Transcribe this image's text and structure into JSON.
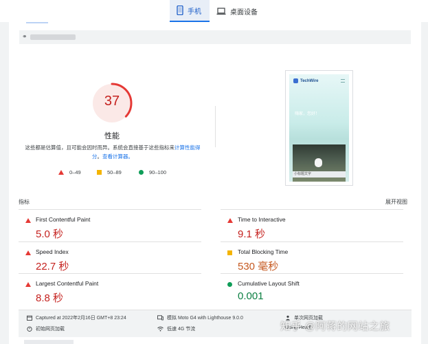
{
  "tabs": [
    {
      "label": "手机",
      "icon": "smartphone-icon",
      "active": true
    },
    {
      "label": "桌面设备",
      "icon": "laptop-icon",
      "active": false
    }
  ],
  "url_bar": {
    "link_icon": "link-icon"
  },
  "performance": {
    "score": "37",
    "score_fraction": 0.37,
    "score_color": "#c5221f",
    "title": "性能",
    "description_prefix": "这些都是估算值，且可能会因时而异。系统会直接基于这些指标来",
    "calc_link": "计算性能得分",
    "description_mid": "。",
    "calculator_link": "查看计算器。"
  },
  "legend": [
    {
      "label": "0–49",
      "shape": "triangle",
      "color": "#e53935"
    },
    {
      "label": "50–89",
      "shape": "square",
      "color": "#f4b400"
    },
    {
      "label": "90–100",
      "shape": "circle",
      "color": "#0f9d58"
    }
  ],
  "preview": {
    "brand": "TechWire",
    "hero_text": "嗨家，您好！",
    "photo_caption": "小标题文字"
  },
  "metrics_section": {
    "title": "指标",
    "expand_label": "展开视图"
  },
  "metrics": [
    {
      "name": "First Contentful Paint",
      "value": "5.0 秒",
      "status": "fail"
    },
    {
      "name": "Time to Interactive",
      "value": "9.1 秒",
      "status": "fail"
    },
    {
      "name": "Speed Index",
      "value": "22.7 秒",
      "status": "fail"
    },
    {
      "name": "Total Blocking Time",
      "value": "530 毫秒",
      "status": "average"
    },
    {
      "name": "Largest Contentful Paint",
      "value": "8.8 秒",
      "status": "fail"
    },
    {
      "name": "Cumulative Layout Shift",
      "value": "0.001",
      "status": "pass"
    }
  ],
  "footer": {
    "captured": "Captured at 2022年2月16日 GMT+8 23:24",
    "initial_load": "初始网页加载",
    "emulated": "模拟 Moto G4 with Lighthouse 9.0.0",
    "throttling": "低速 4G 节流",
    "single_load": "单次网页加载",
    "browser_partial": "Using Headl"
  },
  "watermark": "知乎 @阿蒋的网站之旅"
}
